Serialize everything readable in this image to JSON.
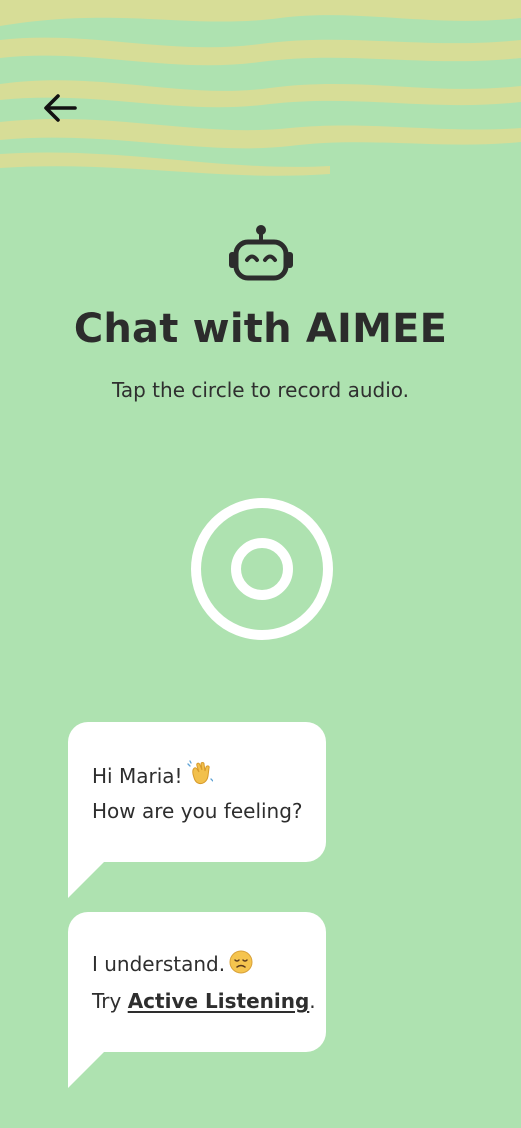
{
  "header": {
    "back_icon": "arrow-left-icon"
  },
  "hero": {
    "icon": "robot-icon",
    "title": "Chat with AIMEE",
    "subtitle": "Tap the circle to record audio."
  },
  "record": {
    "icon": "record-circle-icon"
  },
  "messages": [
    {
      "line1": "Hi Maria!",
      "line1_emoji": "waving-hand-emoji",
      "line2": "How are you feeling?"
    },
    {
      "line1": "I understand.",
      "line1_emoji": "disappointed-face-emoji",
      "line2_prefix": "Try",
      "line2_link": "Active Listening",
      "line2_suffix": "."
    }
  ],
  "colors": {
    "background": "#AEE2B0",
    "waves": "#D7DD97",
    "text": "#2F2F2F",
    "bubble": "#FFFFFF"
  }
}
